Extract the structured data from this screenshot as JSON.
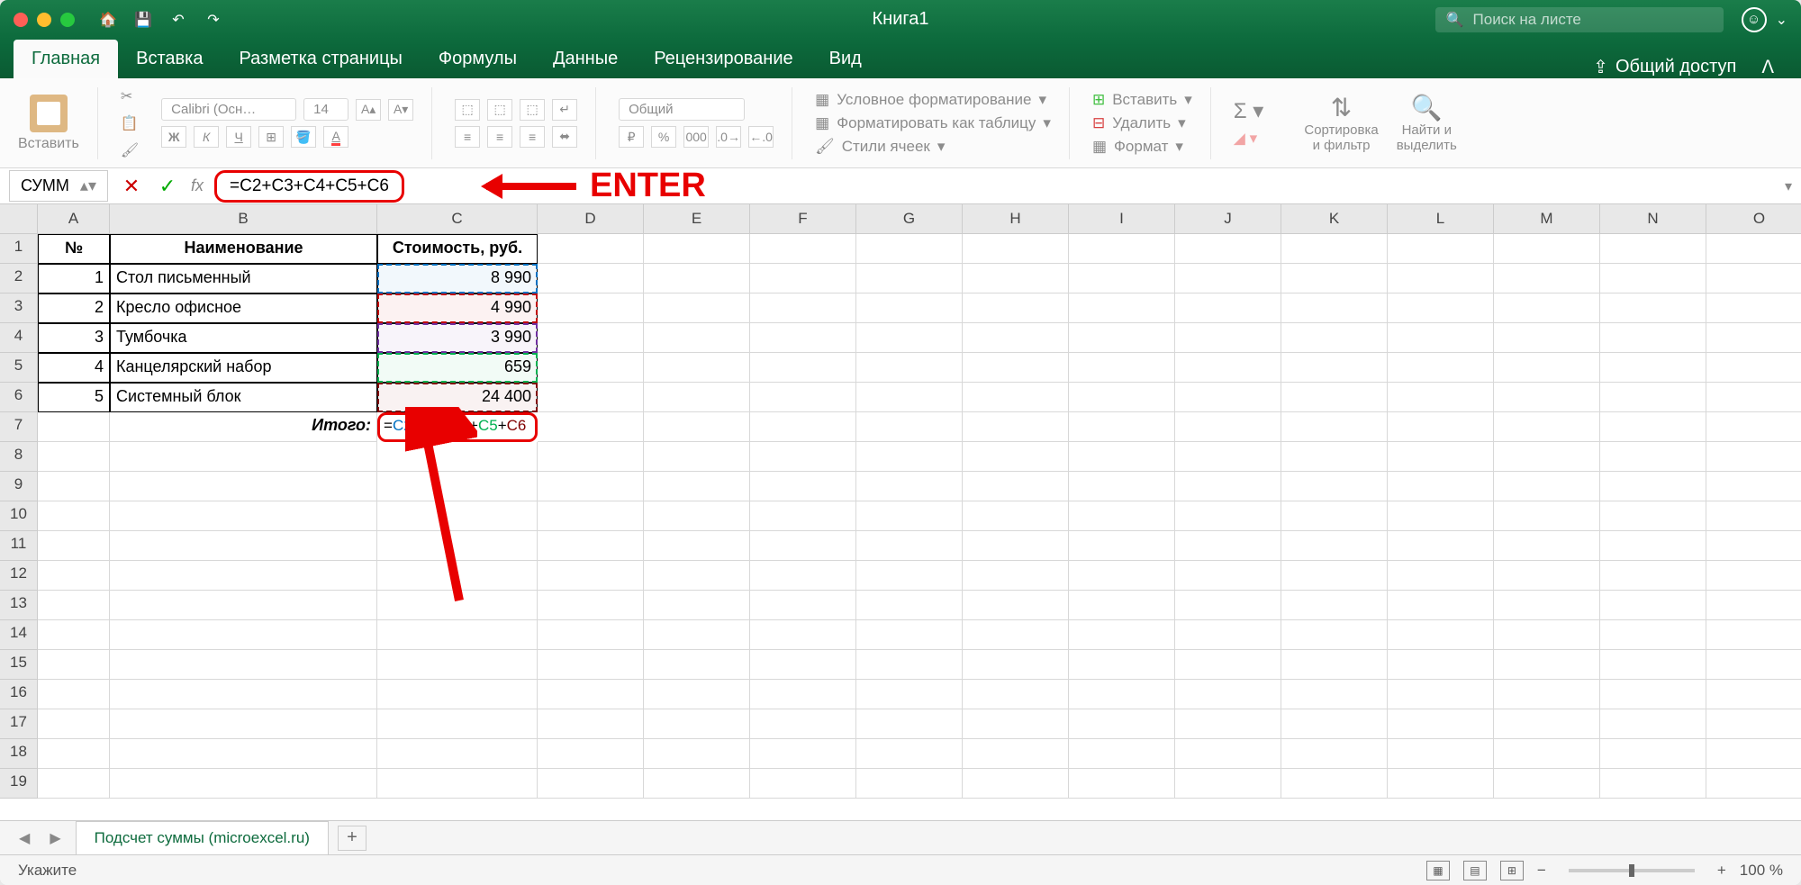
{
  "title": "Книга1",
  "search_placeholder": "Поиск на листе",
  "tabs": [
    "Главная",
    "Вставка",
    "Разметка страницы",
    "Формулы",
    "Данные",
    "Рецензирование",
    "Вид"
  ],
  "share": "Общий доступ",
  "paste_label": "Вставить",
  "font_name": "Calibri (Осн…",
  "font_size": "14",
  "number_format": "Общий",
  "cond_fmt": "Условное форматирование",
  "fmt_table": "Форматировать как таблицу",
  "cell_styles": "Стили ячеек",
  "insert": "Вставить",
  "delete": "Удалить",
  "format": "Формат",
  "sort_filter": "Сортировка\nи фильтр",
  "find_select": "Найти и\nвыделить",
  "name_box": "СУММ",
  "formula": "=C2+C3+C4+C5+C6",
  "annotation": "ENTER",
  "columns": [
    "",
    "A",
    "B",
    "C",
    "D",
    "E",
    "F",
    "G",
    "H",
    "I",
    "J",
    "K",
    "L",
    "M",
    "N",
    "O"
  ],
  "headers": {
    "a": "№",
    "b": "Наименование",
    "c": "Стоимость, руб."
  },
  "rows": [
    {
      "n": "1",
      "name": "Стол письменный",
      "cost": "8 990"
    },
    {
      "n": "2",
      "name": "Кресло офисное",
      "cost": "4 990"
    },
    {
      "n": "3",
      "name": "Тумбочка",
      "cost": "3 990"
    },
    {
      "n": "4",
      "name": "Канцелярский набор",
      "cost": "659"
    },
    {
      "n": "5",
      "name": "Системный блок",
      "cost": "24 400"
    }
  ],
  "total_label": "Итого:",
  "sheet_name": "Подсчет суммы (microexcel.ru)",
  "status": "Укажите",
  "zoom": "100 %",
  "row_count": 19
}
